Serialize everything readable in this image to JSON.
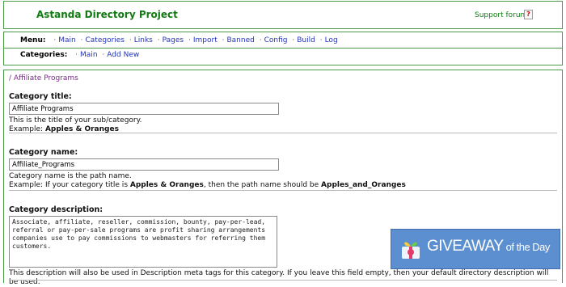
{
  "header": {
    "title": "Astanda Directory Project",
    "support_label": "Support forums",
    "help_glyph": "?"
  },
  "menu": {
    "label": "Menu:",
    "items": [
      "Main",
      "Categories",
      "Links",
      "Pages",
      "Import",
      "Banned",
      "Config",
      "Build",
      "Log"
    ]
  },
  "categories_bar": {
    "label": "Categories:",
    "items": [
      "Main",
      "Add New"
    ]
  },
  "breadcrumb": "/ Affiliate Programs",
  "form": {
    "title": {
      "label": "Category title:",
      "value": "Affiliate Programs",
      "help1": "This is the title of your sub/category.",
      "help2_prefix": "Example: ",
      "help2_bold": "Apples & Oranges"
    },
    "name": {
      "label": "Category name:",
      "value": "Affiliate_Programs",
      "help1": "Category name is the path name.",
      "help2_a": "Example: If your category title is ",
      "help2_b": "Apples & Oranges",
      "help2_c": ", then the path name should be ",
      "help2_d": "Apples_and_Oranges"
    },
    "description": {
      "label": "Category description:",
      "value": "Associate, affiliate, reseller, commission, bounty, pay-per-lead, referral or pay-per-sale programs are profit sharing arrangements companies use to pay commissions to webmasters for referring them customers.",
      "help": "This description will also be used in Description meta tags for this category. If you leave this field empty, then your default directory description will be used."
    }
  },
  "giveaway": {
    "main": "GIVEAWAY",
    "suffix": " of the Day",
    "icon": "gift-icon",
    "color": "#5b8fd0"
  }
}
